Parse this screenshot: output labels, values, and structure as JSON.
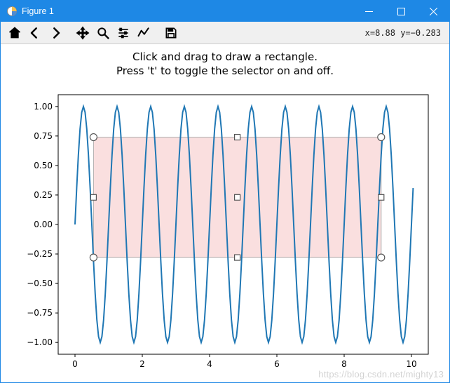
{
  "window": {
    "title": "Figure 1"
  },
  "toolbar": {
    "coord_readout": "x=8.88 y=−0.283",
    "buttons": {
      "home": "home-icon",
      "back": "back-icon",
      "forward": "forward-icon",
      "pan": "move-icon",
      "zoom": "zoom-icon",
      "configure": "sliders-icon",
      "edit": "chart-edit-icon",
      "save": "save-icon"
    }
  },
  "chart_data": {
    "type": "line",
    "title": "Click and drag to draw a rectangle.",
    "subtitle": "Press 't' to toggle the selector on and off.",
    "xlabel": "",
    "ylabel": "",
    "xlim": [
      -0.5,
      10.5
    ],
    "ylim": [
      -1.1,
      1.1
    ],
    "xticks": [
      0,
      2,
      4,
      6,
      8,
      10
    ],
    "yticks": [
      -1.0,
      -0.75,
      -0.5,
      -0.25,
      0.0,
      0.25,
      0.5,
      0.75,
      1.0
    ],
    "series": [
      {
        "name": "sin(2πx)",
        "color": "#1f77b4",
        "x_range": [
          0,
          10.05
        ],
        "x_step": 0.05,
        "fn": "sin_2pi_x"
      }
    ],
    "selection_rect": {
      "x0": 0.55,
      "y0": -0.28,
      "x1": 9.1,
      "y1": 0.74,
      "face": "#f6c9c9",
      "alpha": 0.6,
      "edge": "#b0b0b0"
    },
    "handles": {
      "corners": [
        [
          0.55,
          0.74
        ],
        [
          9.1,
          0.74
        ],
        [
          0.55,
          -0.28
        ],
        [
          9.1,
          -0.28
        ]
      ],
      "edges": [
        [
          4.825,
          0.74
        ],
        [
          4.825,
          -0.28
        ],
        [
          0.55,
          0.23
        ],
        [
          9.1,
          0.23
        ]
      ],
      "center": [
        4.825,
        0.23
      ]
    }
  },
  "watermark": "https://blog.csdn.net/mighty13"
}
